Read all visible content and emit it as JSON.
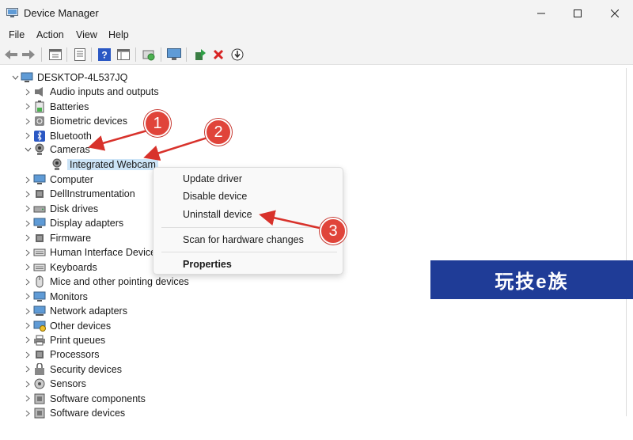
{
  "window": {
    "title": "Device Manager"
  },
  "menu": [
    "File",
    "Action",
    "View",
    "Help"
  ],
  "toolbar_icons": [
    "back-icon",
    "forward-icon",
    "properties-icon",
    "update-icon",
    "help-icon",
    "view-icon",
    "scan-icon",
    "monitor-icon",
    "enable-icon",
    "uninstall-icon",
    "download-icon"
  ],
  "tree": {
    "root": "DESKTOP-4L537JQ",
    "before_cameras": [
      "Audio inputs and outputs",
      "Batteries",
      "Biometric devices",
      "Bluetooth"
    ],
    "cameras": "Cameras",
    "camera_child": "Integrated Webcam",
    "after_cameras": [
      "Computer",
      "DellInstrumentation",
      "Disk drives",
      "Display adapters",
      "Firmware",
      "Human Interface Device",
      "Keyboards",
      "Mice and other pointing devices",
      "Monitors",
      "Network adapters",
      "Other devices",
      "Print queues",
      "Processors",
      "Security devices",
      "Sensors",
      "Software components",
      "Software devices"
    ]
  },
  "context_menu": {
    "update": "Update driver",
    "disable": "Disable device",
    "uninstall": "Uninstall device",
    "scan": "Scan for hardware changes",
    "properties": "Properties"
  },
  "callouts": [
    "1",
    "2",
    "3"
  ],
  "watermark": "玩技e族",
  "colors": {
    "chrome": "#f3f3f3",
    "selection": "#cce4f7",
    "callout": "#e0443a",
    "arrow": "#d8322b",
    "watermark_bg": "#1f3c97"
  }
}
